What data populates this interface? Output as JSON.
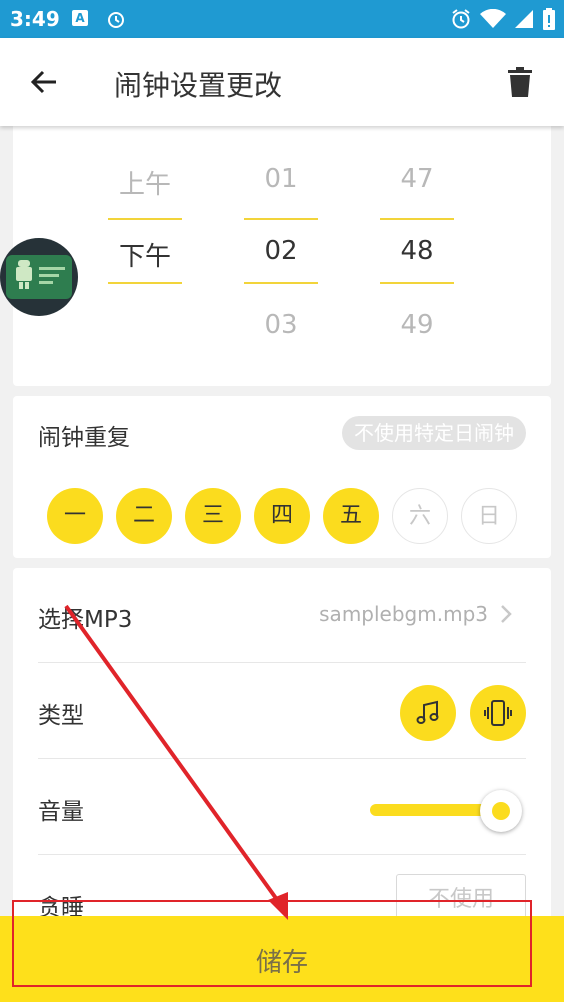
{
  "status_bar": {
    "time": "3:49",
    "left_icons": [
      "a-icon",
      "alarm-icon"
    ],
    "right_icons": [
      "alarm-icon",
      "wifi-icon",
      "signal-icon",
      "battery-icon"
    ]
  },
  "app_bar": {
    "title": "闹钟设置更改",
    "back_icon": "arrow-left-icon",
    "delete_icon": "trash-icon"
  },
  "time_picker": {
    "ampm": {
      "above": "上午",
      "selected": "下午",
      "below": ""
    },
    "hour": {
      "above": "01",
      "selected": "02",
      "below": "03"
    },
    "minute": {
      "above": "47",
      "selected": "48",
      "below": "49"
    }
  },
  "repeat": {
    "label": "闹钟重复",
    "badge": "不使用特定日闹钟",
    "days": [
      {
        "label": "一",
        "active": true
      },
      {
        "label": "二",
        "active": true
      },
      {
        "label": "三",
        "active": true
      },
      {
        "label": "四",
        "active": true
      },
      {
        "label": "五",
        "active": true
      },
      {
        "label": "六",
        "active": false
      },
      {
        "label": "日",
        "active": false
      }
    ]
  },
  "settings": {
    "mp3": {
      "label": "选择MP3",
      "value": "samplebgm.mp3"
    },
    "type": {
      "label": "类型",
      "options": [
        "music-note-icon",
        "vibrate-icon"
      ]
    },
    "volume": {
      "label": "音量",
      "level": 1.0
    },
    "snooze": {
      "label": "贪睡",
      "value": "不使用"
    }
  },
  "save": {
    "label": "储存"
  },
  "colors": {
    "accent": "#fbdc1e",
    "status_bar": "#1f9ad2",
    "annotation": "#e0242a"
  }
}
